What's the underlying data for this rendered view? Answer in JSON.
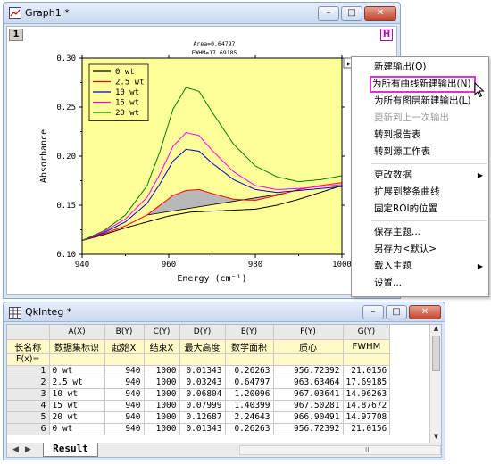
{
  "graph_window": {
    "title": "Graph1 *",
    "layer_number": "1",
    "h_button": "H",
    "menu_button": "▸"
  },
  "annotation": {
    "area": "Area=0.64797",
    "fwhm": "FWHM=17.69185"
  },
  "chart_data": {
    "type": "line",
    "xlabel": "Energy (cm⁻¹)",
    "ylabel": "Absorbance",
    "xlim": [
      940,
      1000
    ],
    "ylim": [
      0.1,
      0.3
    ],
    "x_ticks": [
      "940",
      "960",
      "980",
      "1000"
    ],
    "y_ticks": [
      "0.10",
      "0.15",
      "0.20",
      "0.25",
      "0.30"
    ],
    "roi_range": [
      940,
      1000
    ],
    "legend_placement": "top-left",
    "series": [
      {
        "name": "0 wt",
        "color": "#000000",
        "x": [
          940,
          945,
          950,
          955,
          960,
          965,
          970,
          975,
          980,
          985,
          990,
          995,
          1000
        ],
        "y": [
          0.114,
          0.12,
          0.127,
          0.133,
          0.139,
          0.143,
          0.144,
          0.145,
          0.146,
          0.15,
          0.156,
          0.163,
          0.17
        ]
      },
      {
        "name": "2.5 wt",
        "color": "#ff0000",
        "x": [
          940,
          945,
          950,
          955,
          958,
          961,
          964,
          967,
          970,
          975,
          980,
          985,
          990,
          995,
          1000
        ],
        "y": [
          0.114,
          0.121,
          0.129,
          0.14,
          0.15,
          0.16,
          0.165,
          0.166,
          0.162,
          0.156,
          0.155,
          0.16,
          0.166,
          0.17,
          0.173
        ]
      },
      {
        "name": "10 wt",
        "color": "#0000cc",
        "x": [
          940,
          945,
          950,
          955,
          958,
          961,
          964,
          967,
          970,
          975,
          980,
          985,
          990,
          995,
          1000
        ],
        "y": [
          0.114,
          0.122,
          0.133,
          0.152,
          0.172,
          0.195,
          0.207,
          0.205,
          0.193,
          0.176,
          0.166,
          0.163,
          0.165,
          0.167,
          0.169
        ]
      },
      {
        "name": "15 wt",
        "color": "#ff00ff",
        "x": [
          940,
          945,
          950,
          955,
          958,
          961,
          964,
          967,
          970,
          975,
          980,
          985,
          990,
          995,
          1000
        ],
        "y": [
          0.114,
          0.123,
          0.136,
          0.158,
          0.182,
          0.21,
          0.224,
          0.221,
          0.206,
          0.184,
          0.17,
          0.166,
          0.167,
          0.169,
          0.171
        ]
      },
      {
        "name": "20 wt",
        "color": "#008000",
        "x": [
          940,
          945,
          950,
          955,
          958,
          961,
          964,
          967,
          970,
          975,
          980,
          985,
          990,
          995,
          1000
        ],
        "y": [
          0.114,
          0.124,
          0.14,
          0.17,
          0.205,
          0.248,
          0.27,
          0.266,
          0.245,
          0.212,
          0.19,
          0.179,
          0.174,
          0.176,
          0.18
        ]
      }
    ],
    "integrated_area": {
      "series": "2.5 wt",
      "from": 955,
      "to": 987,
      "fill": "#b8b8b8"
    }
  },
  "context_menu": {
    "items": [
      {
        "label": "新建输出(O)",
        "state": "normal"
      },
      {
        "label": "为所有曲线新建输出(N)",
        "state": "highlight"
      },
      {
        "label": "为所有图层新建输出(L)",
        "state": "normal"
      },
      {
        "label": "更新到上一次输出",
        "state": "disabled"
      },
      {
        "label": "转到报告表",
        "state": "normal"
      },
      {
        "label": "转到源工作表",
        "state": "normal"
      },
      {
        "label": "更改数据",
        "state": "submenu"
      },
      {
        "label": "扩展到整条曲线",
        "state": "normal"
      },
      {
        "label": "固定ROI的位置",
        "state": "normal"
      },
      {
        "label": "保存主题...",
        "state": "normal"
      },
      {
        "label": "另存为<默认>",
        "state": "normal"
      },
      {
        "label": "载入主题",
        "state": "submenu"
      },
      {
        "label": "设置...",
        "state": "normal"
      }
    ]
  },
  "integ_window": {
    "title": "QkInteg *",
    "columns": [
      "A(X)",
      "B(Y)",
      "C(Y)",
      "D(Y)",
      "E(Y)",
      "F(Y)",
      "G(Y)"
    ],
    "long_names": [
      "数据集标识",
      "起始X",
      "结束X",
      "最大高度",
      "数学面积",
      "质心",
      "FWHM"
    ],
    "row_label_long_name": "长名称",
    "row_label_fx": "F(x)=",
    "rows": [
      {
        "n": "1",
        "cells": [
          "0 wt",
          "940",
          "1000",
          "0.01343",
          "0.26263",
          "956.72392",
          "21.0156"
        ]
      },
      {
        "n": "2",
        "cells": [
          "2.5 wt",
          "940",
          "1000",
          "0.03243",
          "0.64797",
          "963.63464",
          "17.69185"
        ]
      },
      {
        "n": "3",
        "cells": [
          "10 wt",
          "940",
          "1000",
          "0.06804",
          "1.20096",
          "967.03641",
          "14.96263"
        ]
      },
      {
        "n": "4",
        "cells": [
          "15 wt",
          "940",
          "1000",
          "0.07999",
          "1.40399",
          "967.50281",
          "14.87672"
        ]
      },
      {
        "n": "5",
        "cells": [
          "20 wt",
          "940",
          "1000",
          "0.12687",
          "2.24643",
          "966.90491",
          "14.97708"
        ]
      },
      {
        "n": "6",
        "cells": [
          "0 wt",
          "940",
          "1000",
          "0.01343",
          "0.26263",
          "956.72392",
          "21.0156"
        ]
      }
    ],
    "sheet_tab": "Result",
    "grip": "lll"
  }
}
